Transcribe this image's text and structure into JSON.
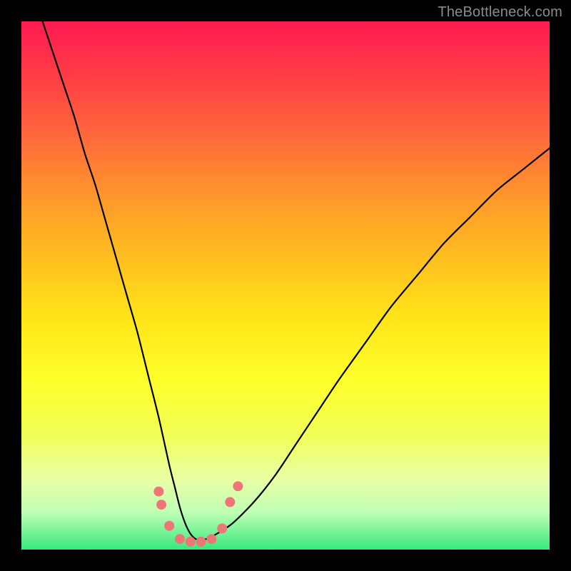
{
  "watermark": "TheBottleneck.com",
  "chart_data": {
    "type": "line",
    "title": "",
    "xlabel": "",
    "ylabel": "",
    "xlim": [
      0,
      100
    ],
    "ylim": [
      0,
      100
    ],
    "grid": false,
    "legend": false,
    "background": "rainbow-vertical-gradient",
    "series": [
      {
        "name": "bottleneck-curve",
        "color": "#000000",
        "x": [
          4,
          6,
          8,
          10,
          12,
          14,
          16,
          18,
          20,
          22,
          24,
          26,
          28,
          29,
          30,
          31,
          32,
          33,
          34,
          35,
          37,
          40,
          44,
          48,
          52,
          56,
          60,
          65,
          70,
          75,
          80,
          85,
          90,
          95,
          100
        ],
        "values": [
          100,
          94,
          88,
          82,
          75,
          69,
          62,
          55,
          48,
          41,
          33,
          25,
          16,
          12,
          8,
          5,
          3,
          2,
          2,
          2,
          3,
          5,
          9,
          14,
          20,
          26,
          32,
          39,
          46,
          52,
          58,
          63,
          68,
          72,
          76
        ]
      }
    ],
    "markers": [
      {
        "name": "dot-left-upper",
        "x": 26,
        "y": 11,
        "r": 7,
        "color": "#ef7676"
      },
      {
        "name": "dot-left-lower",
        "x": 26.5,
        "y": 8.5,
        "r": 7,
        "color": "#ef7676"
      },
      {
        "name": "dot-left-low",
        "x": 28,
        "y": 4.5,
        "r": 7,
        "color": "#ef7676"
      },
      {
        "name": "dot-floor-1",
        "x": 30,
        "y": 2,
        "r": 7,
        "color": "#ef7676"
      },
      {
        "name": "dot-floor-2",
        "x": 32,
        "y": 1.5,
        "r": 7,
        "color": "#ef7676"
      },
      {
        "name": "dot-floor-3",
        "x": 34,
        "y": 1.5,
        "r": 7,
        "color": "#ef7676"
      },
      {
        "name": "dot-floor-4",
        "x": 36,
        "y": 2,
        "r": 7,
        "color": "#ef7676"
      },
      {
        "name": "dot-right-low",
        "x": 38,
        "y": 4,
        "r": 7,
        "color": "#ef7676"
      },
      {
        "name": "dot-right-upper",
        "x": 39.5,
        "y": 9,
        "r": 7,
        "color": "#ef7676"
      },
      {
        "name": "dot-right-top",
        "x": 41,
        "y": 12,
        "r": 7,
        "color": "#ef7676"
      }
    ]
  }
}
